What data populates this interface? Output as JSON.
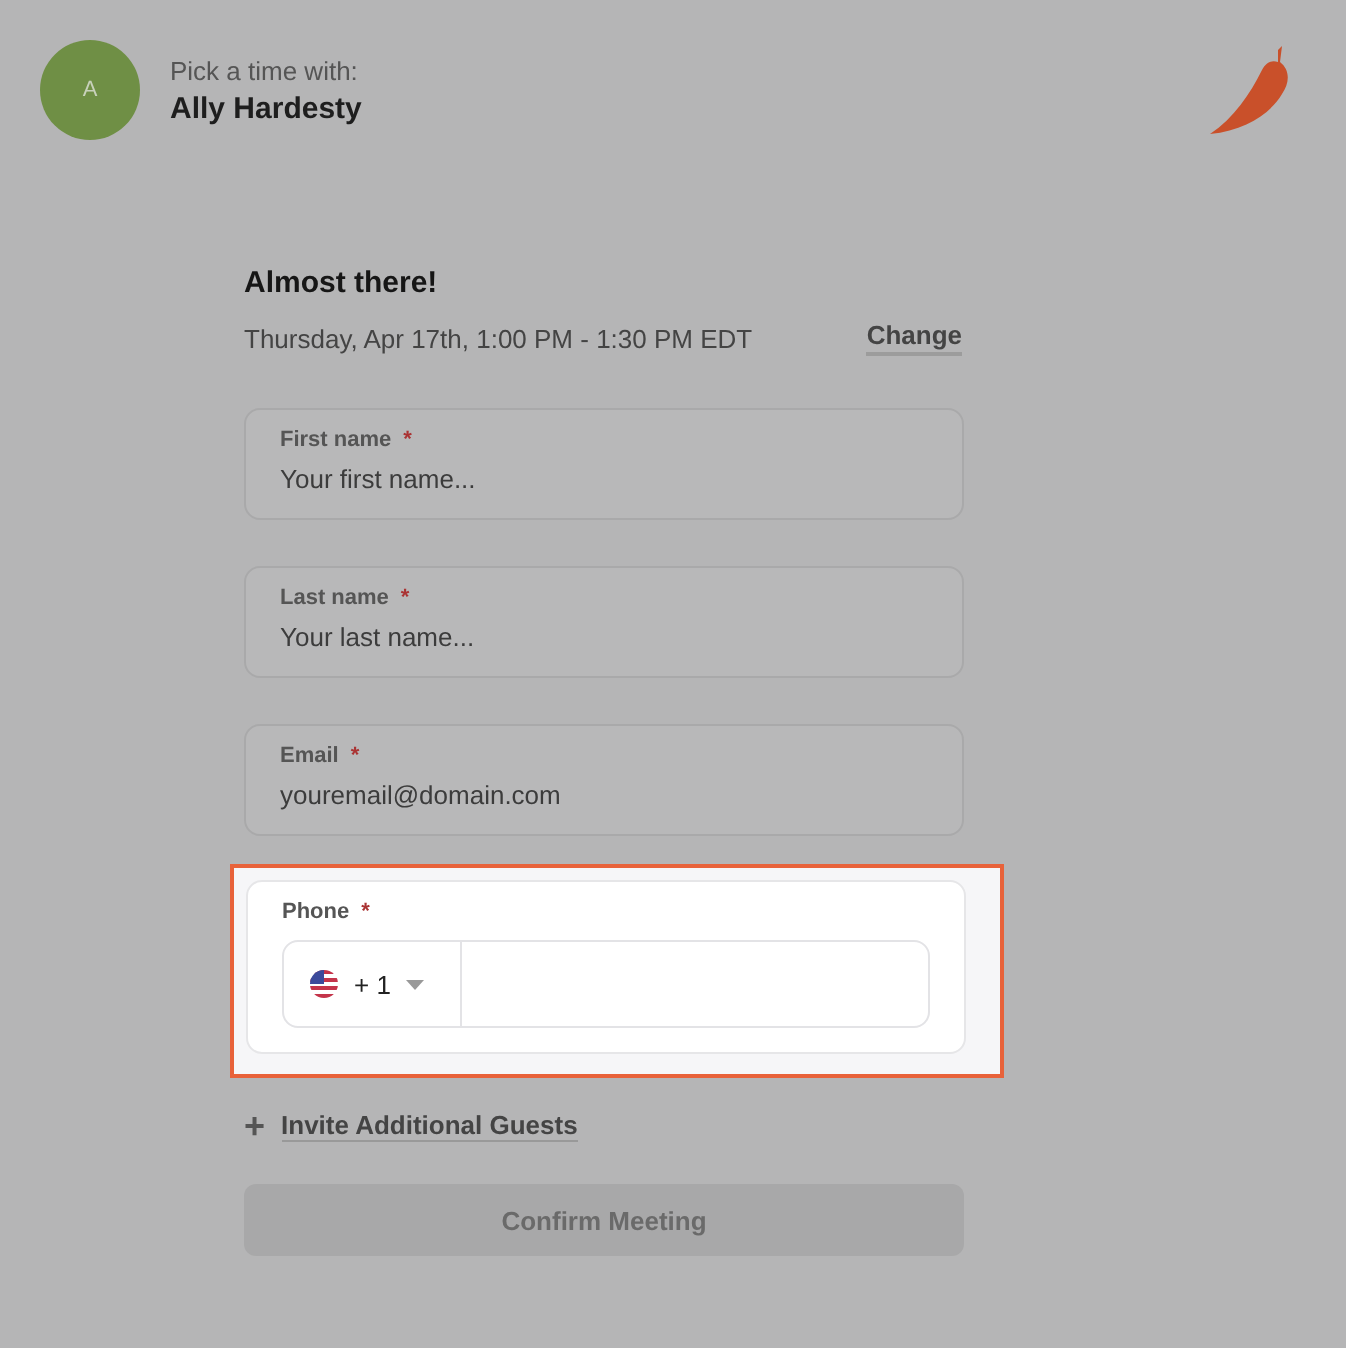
{
  "header": {
    "avatar": "A",
    "subtitle": "Pick a time with:",
    "host": "Ally Hardesty"
  },
  "booking": {
    "title": "Almost there!",
    "time": "Thursday, Apr 17th, 1:00 PM - 1:30 PM EDT",
    "change": "Change"
  },
  "fields": [
    {
      "kind": "text",
      "label": "First name",
      "required": true,
      "placeholder": "Your first name...",
      "highlighted": false
    },
    {
      "kind": "text",
      "label": "Last name",
      "required": true,
      "placeholder": "Your last name...",
      "highlighted": false
    },
    {
      "kind": "text",
      "label": "Email",
      "required": true,
      "placeholder": "youremail@domain.com",
      "highlighted": false
    },
    {
      "kind": "phone",
      "label": "Phone",
      "required": true,
      "code": "+ 1",
      "highlighted": true
    }
  ],
  "required_mark": "*",
  "invite": {
    "icon": "+",
    "label": "Invite Additional Guests"
  },
  "confirm": {
    "label": "Confirm Meeting",
    "disabled": true
  }
}
